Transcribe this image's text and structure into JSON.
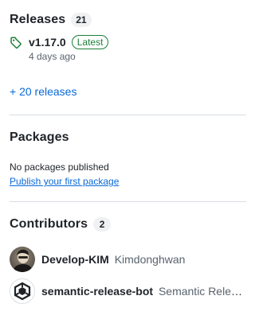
{
  "releases": {
    "title": "Releases",
    "count": "21",
    "latest": {
      "name": "v1.17.0",
      "badge": "Latest",
      "date": "4 days ago"
    },
    "more_link": "+ 20 releases"
  },
  "packages": {
    "title": "Packages",
    "empty_text": "No packages published",
    "publish_link": "Publish your first package"
  },
  "contributors": {
    "title": "Contributors",
    "count": "2",
    "items": [
      {
        "login": "Develop-KIM",
        "name": "Kimdonghwan",
        "avatar": "photo-avatar"
      },
      {
        "login": "semantic-release-bot",
        "name": "Semantic Release Bot",
        "avatar": "semantic-release-logo"
      }
    ]
  },
  "colors": {
    "link": "#0969da",
    "latest_badge": "#1a7f37",
    "muted": "#59636e"
  },
  "icons": {
    "tag": "tag-icon"
  }
}
